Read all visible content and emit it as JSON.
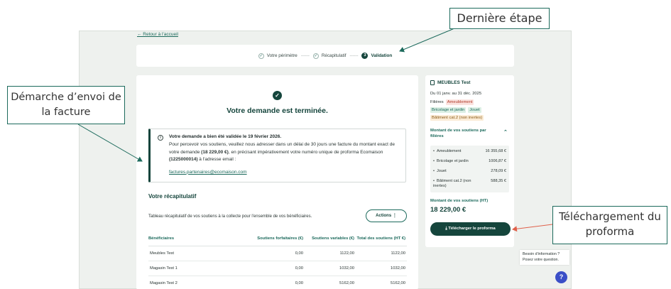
{
  "nav": {
    "back_label": "← Retour à l'accueil"
  },
  "stepper": {
    "steps": [
      {
        "label": "Votre périmètre",
        "marker": "✓"
      },
      {
        "label": "Récapitulatif",
        "marker": "✓"
      },
      {
        "label": "Validation",
        "marker": "3"
      }
    ],
    "separator": "------"
  },
  "confirmation": {
    "icon": "check-icon",
    "title": "Votre demande est terminée.",
    "info": {
      "title": "Votre demande a bien été validée le 19 février 2026.",
      "text_1": "Pour percevoir vos soutiens, veuillez nous adresser dans un délai de 30 jours une facture du montant exact de votre demande ",
      "amount": "(18 229,00 €)",
      "text_2": ", en précisant impérativement votre numéro unique de proforma Ecomaison ",
      "proforma": "(1225000014)",
      "text_3": " à l'adresse email :",
      "email": "factures.partenaires@ecomaison.com"
    }
  },
  "recap": {
    "title": "Votre récapitulatif",
    "description": "Tableau récapitulatif de vos soutiens à la collecte pour l'ensemble de vos bénéficiaires.",
    "actions_label": "Actions  ⋮",
    "columns": [
      "Bénéficiaires",
      "Soutiens forfaitaires (€)",
      "Soutiens variables (€)",
      "Total des soutiens (HT €)"
    ],
    "rows": [
      [
        "Meubles Test",
        "0,00",
        "1122,00",
        "1122,00"
      ],
      [
        "Magasin Test 1",
        "0,00",
        "1032,00",
        "1032,00"
      ],
      [
        "Magasin Test 2",
        "0,00",
        "5162,00",
        "5162,00"
      ]
    ]
  },
  "summary": {
    "name": "MEUBLES Test",
    "period": "Du 01 janv. au 31 déc. 2025",
    "filieres_label": "Filières",
    "tags": [
      {
        "label": "Ameublement",
        "tone": "red"
      },
      {
        "label": "Bricolage et jardin",
        "tone": "green"
      },
      {
        "label": "Jouet",
        "tone": "green"
      },
      {
        "label": "Bâtiment cat.2 (non inertes)",
        "tone": "orange"
      }
    ],
    "soutiens_link": "Montant de vos soutiens par filières",
    "soutiens": [
      {
        "label": "Ameublement",
        "value": "16 355,68 €"
      },
      {
        "label": "Bricolage et jardin",
        "value": "1006,87 €"
      },
      {
        "label": "Jouet",
        "value": "278,09 €"
      },
      {
        "label": "Bâtiment cat.2 (non inertes)",
        "value": "588,35 €"
      }
    ],
    "total_label": "Montant de vos soutiens (HT)",
    "total_value": "18 229,00 €",
    "download_label": "⤓  Télécharger le proforma"
  },
  "help": {
    "text": "Besoin d'information ? Posez votre question.",
    "button": "?"
  },
  "annotations": {
    "derniere_etape": "Dernière étape",
    "demarche": "Démarche d’envoi de la facture",
    "telechargement": "Téléchargement du proforma"
  },
  "colors": {
    "primary": "#15453c",
    "accent": "#1c6a5c",
    "annotation_arrow": "#1c6a5c",
    "download_arrow": "#e0604a",
    "help_button": "#3b4fc7"
  }
}
